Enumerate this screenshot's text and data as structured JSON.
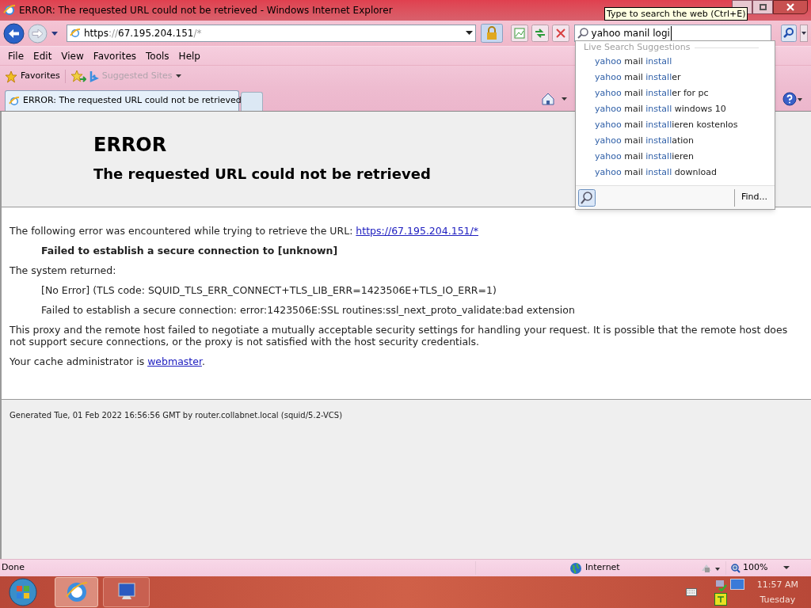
{
  "window": {
    "title": "ERROR: The requested URL could not be retrieved - Windows Internet Explorer"
  },
  "address_bar": {
    "segments": [
      {
        "text": "https",
        "dim": false
      },
      {
        "text": "://",
        "dim": true
      },
      {
        "text": "67.195.204.151",
        "dim": false
      },
      {
        "text": "/*",
        "dim": true
      }
    ]
  },
  "search": {
    "value": "yahoo manil logi",
    "tooltip": "Type to search the web (Ctrl+E)",
    "suggestions_header": "Live Search Suggestions",
    "find_button": "Find...",
    "suggestions": [
      {
        "segments": [
          {
            "text": "yahoo ",
            "highlight": true
          },
          {
            "text": "mail ",
            "highlight": false
          },
          {
            "text": "install",
            "highlight": true
          }
        ]
      },
      {
        "segments": [
          {
            "text": "yahoo ",
            "highlight": true
          },
          {
            "text": "mail ",
            "highlight": false
          },
          {
            "text": "install",
            "highlight": true
          },
          {
            "text": "er",
            "highlight": false
          }
        ]
      },
      {
        "segments": [
          {
            "text": "yahoo ",
            "highlight": true
          },
          {
            "text": "mail ",
            "highlight": false
          },
          {
            "text": "install",
            "highlight": true
          },
          {
            "text": "er for pc",
            "highlight": false
          }
        ]
      },
      {
        "segments": [
          {
            "text": "yahoo ",
            "highlight": true
          },
          {
            "text": "mail ",
            "highlight": false
          },
          {
            "text": "install",
            "highlight": true
          },
          {
            "text": " windows 10",
            "highlight": false
          }
        ]
      },
      {
        "segments": [
          {
            "text": "yahoo ",
            "highlight": true
          },
          {
            "text": "mail ",
            "highlight": false
          },
          {
            "text": "install",
            "highlight": true
          },
          {
            "text": "ieren kostenlos",
            "highlight": false
          }
        ]
      },
      {
        "segments": [
          {
            "text": "yahoo ",
            "highlight": true
          },
          {
            "text": "mail ",
            "highlight": false
          },
          {
            "text": "install",
            "highlight": true
          },
          {
            "text": "ation",
            "highlight": false
          }
        ]
      },
      {
        "segments": [
          {
            "text": "yahoo ",
            "highlight": true
          },
          {
            "text": "mail ",
            "highlight": false
          },
          {
            "text": "install",
            "highlight": true
          },
          {
            "text": "ieren",
            "highlight": false
          }
        ]
      },
      {
        "segments": [
          {
            "text": "yahoo ",
            "highlight": true
          },
          {
            "text": "mail ",
            "highlight": false
          },
          {
            "text": "install",
            "highlight": true
          },
          {
            "text": " download",
            "highlight": false
          }
        ]
      }
    ]
  },
  "menu": [
    "File",
    "Edit",
    "View",
    "Favorites",
    "Tools",
    "Help"
  ],
  "favorites_bar": {
    "favorites": "Favorites",
    "suggested_sites": "Suggested Sites"
  },
  "tabs": [
    {
      "label": "ERROR: The requested URL could not be retrieved",
      "selected": true
    }
  ],
  "page": {
    "heading": "ERROR",
    "subheading": "The requested URL could not be retrieved",
    "blocks": [
      {
        "kind": "link_paragraph",
        "text": "The following error was encountered while trying to retrieve the URL: ",
        "link": "https://67.195.204.151/*"
      },
      {
        "kind": "indented_bold",
        "text": "Failed to establish a secure connection to [unknown]"
      },
      {
        "kind": "paragraph",
        "text": "The system returned:"
      },
      {
        "kind": "indented",
        "text": "[No Error] (TLS code: SQUID_TLS_ERR_CONNECT+TLS_LIB_ERR=1423506E+TLS_IO_ERR=1)"
      },
      {
        "kind": "indented",
        "text": "Failed to establish a secure connection: error:1423506E:SSL routines:ssl_next_proto_validate:bad extension"
      },
      {
        "kind": "paragraph",
        "text": "This proxy and the remote host failed to negotiate a mutually acceptable security settings for handling your request. It is possible that the remote host does not support secure connections, or the proxy is not satisfied with the host security credentials."
      },
      {
        "kind": "link_paragraph",
        "text": "Your cache administrator is ",
        "link": "webmaster",
        "after": "."
      }
    ],
    "footer": "Generated Tue, 01 Feb 2022 16:56:56 GMT by router.collabnet.local (squid/5.2-VCS)"
  },
  "status_bar": {
    "status": "Done",
    "zone": "Internet",
    "zoom": "100%"
  },
  "taskbar": {
    "time": "11:57 AM",
    "day": "Tuesday"
  }
}
